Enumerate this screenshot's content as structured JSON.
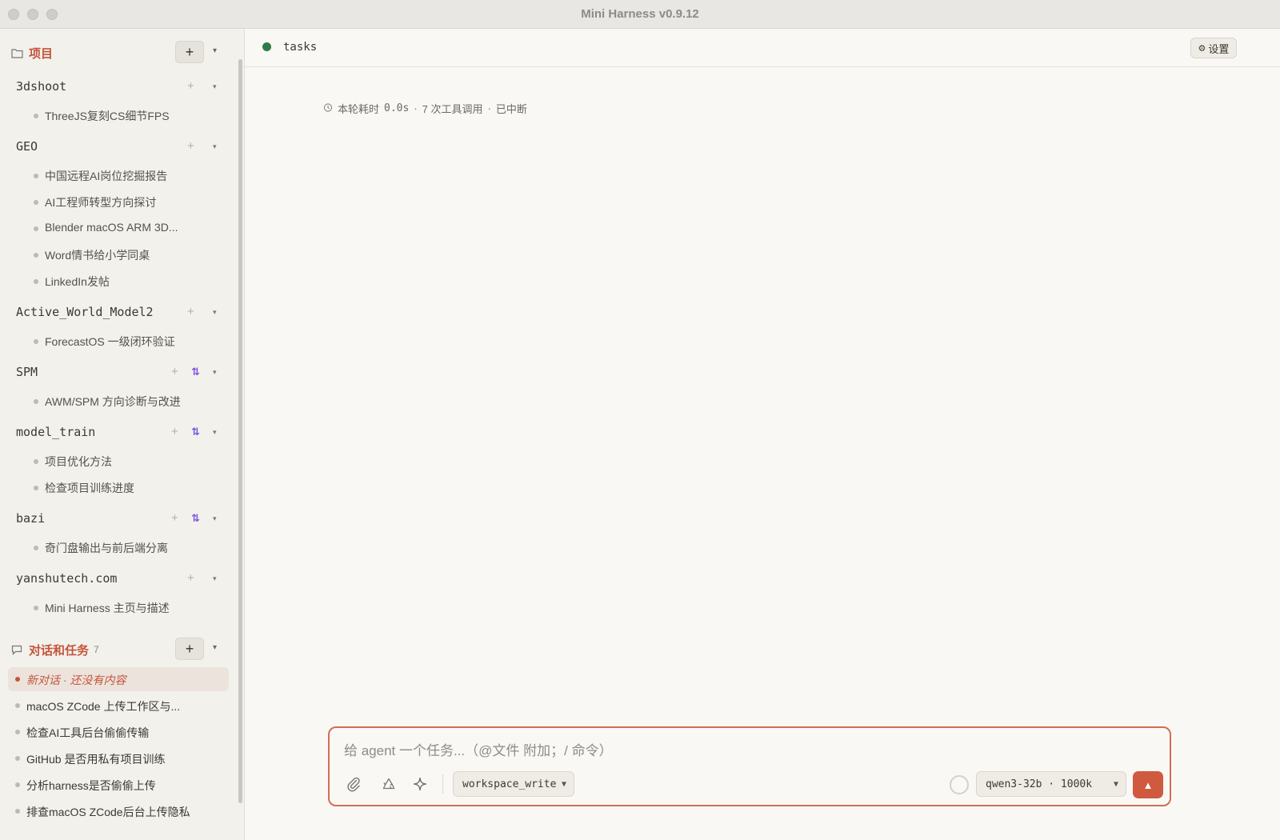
{
  "window": {
    "title": "Mini Harness v0.9.12"
  },
  "sidebar": {
    "projects_section": {
      "title": "项目",
      "add": "+",
      "caret": "▾"
    },
    "projects": [
      {
        "name": "3dshoot",
        "sync": false,
        "threads": [
          "ThreeJS复刻CS细节FPS"
        ]
      },
      {
        "name": "GEO",
        "sync": false,
        "threads": [
          "中国远程AI岗位挖掘报告",
          "AI工程师转型方向探讨",
          "Blender macOS ARM 3D...",
          "Word情书给小学同桌",
          "LinkedIn发帖"
        ]
      },
      {
        "name": "Active_World_Model2",
        "sync": false,
        "threads": [
          "ForecastOS 一级闭环验证"
        ]
      },
      {
        "name": "SPM",
        "sync": true,
        "threads": [
          "AWM/SPM 方向诊断与改进"
        ]
      },
      {
        "name": "model_train",
        "sync": true,
        "threads": [
          "项目优化方法",
          "检查项目训练进度"
        ]
      },
      {
        "name": "bazi",
        "sync": true,
        "threads": [
          "奇门盘输出与前后端分离"
        ]
      },
      {
        "name": "yanshutech.com",
        "sync": false,
        "threads": [
          "Mini Harness 主页与描述"
        ]
      }
    ],
    "project_plus": "+",
    "sync_glyph": "⇅",
    "caret": "▾",
    "conversations_section": {
      "title": "对话和任务",
      "count": "7",
      "add": "+",
      "caret": "▾"
    },
    "conversations": [
      {
        "label": "新对话 · 还没有内容",
        "active": true
      },
      {
        "label": "macOS ZCode 上传工作区与...",
        "active": false
      },
      {
        "label": "检查AI工具后台偷偷传输",
        "active": false
      },
      {
        "label": "GitHub 是否用私有项目训练",
        "active": false
      },
      {
        "label": "分析harness是否偷偷上传",
        "active": false
      },
      {
        "label": "排查macOS ZCode后台上传隐私",
        "active": false
      }
    ]
  },
  "main": {
    "tab": {
      "label": "tasks",
      "status_color": "#2f7a4a"
    },
    "settings_label": "设置",
    "settings_glyph": "⚙",
    "stats": {
      "prefix": "本轮耗时",
      "duration": "0.0s",
      "sep": "·",
      "tool_calls": "7 次工具调用",
      "state": "已中断"
    },
    "composer": {
      "placeholder": "给 agent 一个任务...（@文件 附加；/ 命令）",
      "mode": "workspace_write",
      "model": "qwen3-32b · 1000k",
      "send_glyph": "▲"
    }
  },
  "colors": {
    "accent": "#c4553a",
    "send": "#cf5a3f",
    "sync": "#7a54e0"
  }
}
